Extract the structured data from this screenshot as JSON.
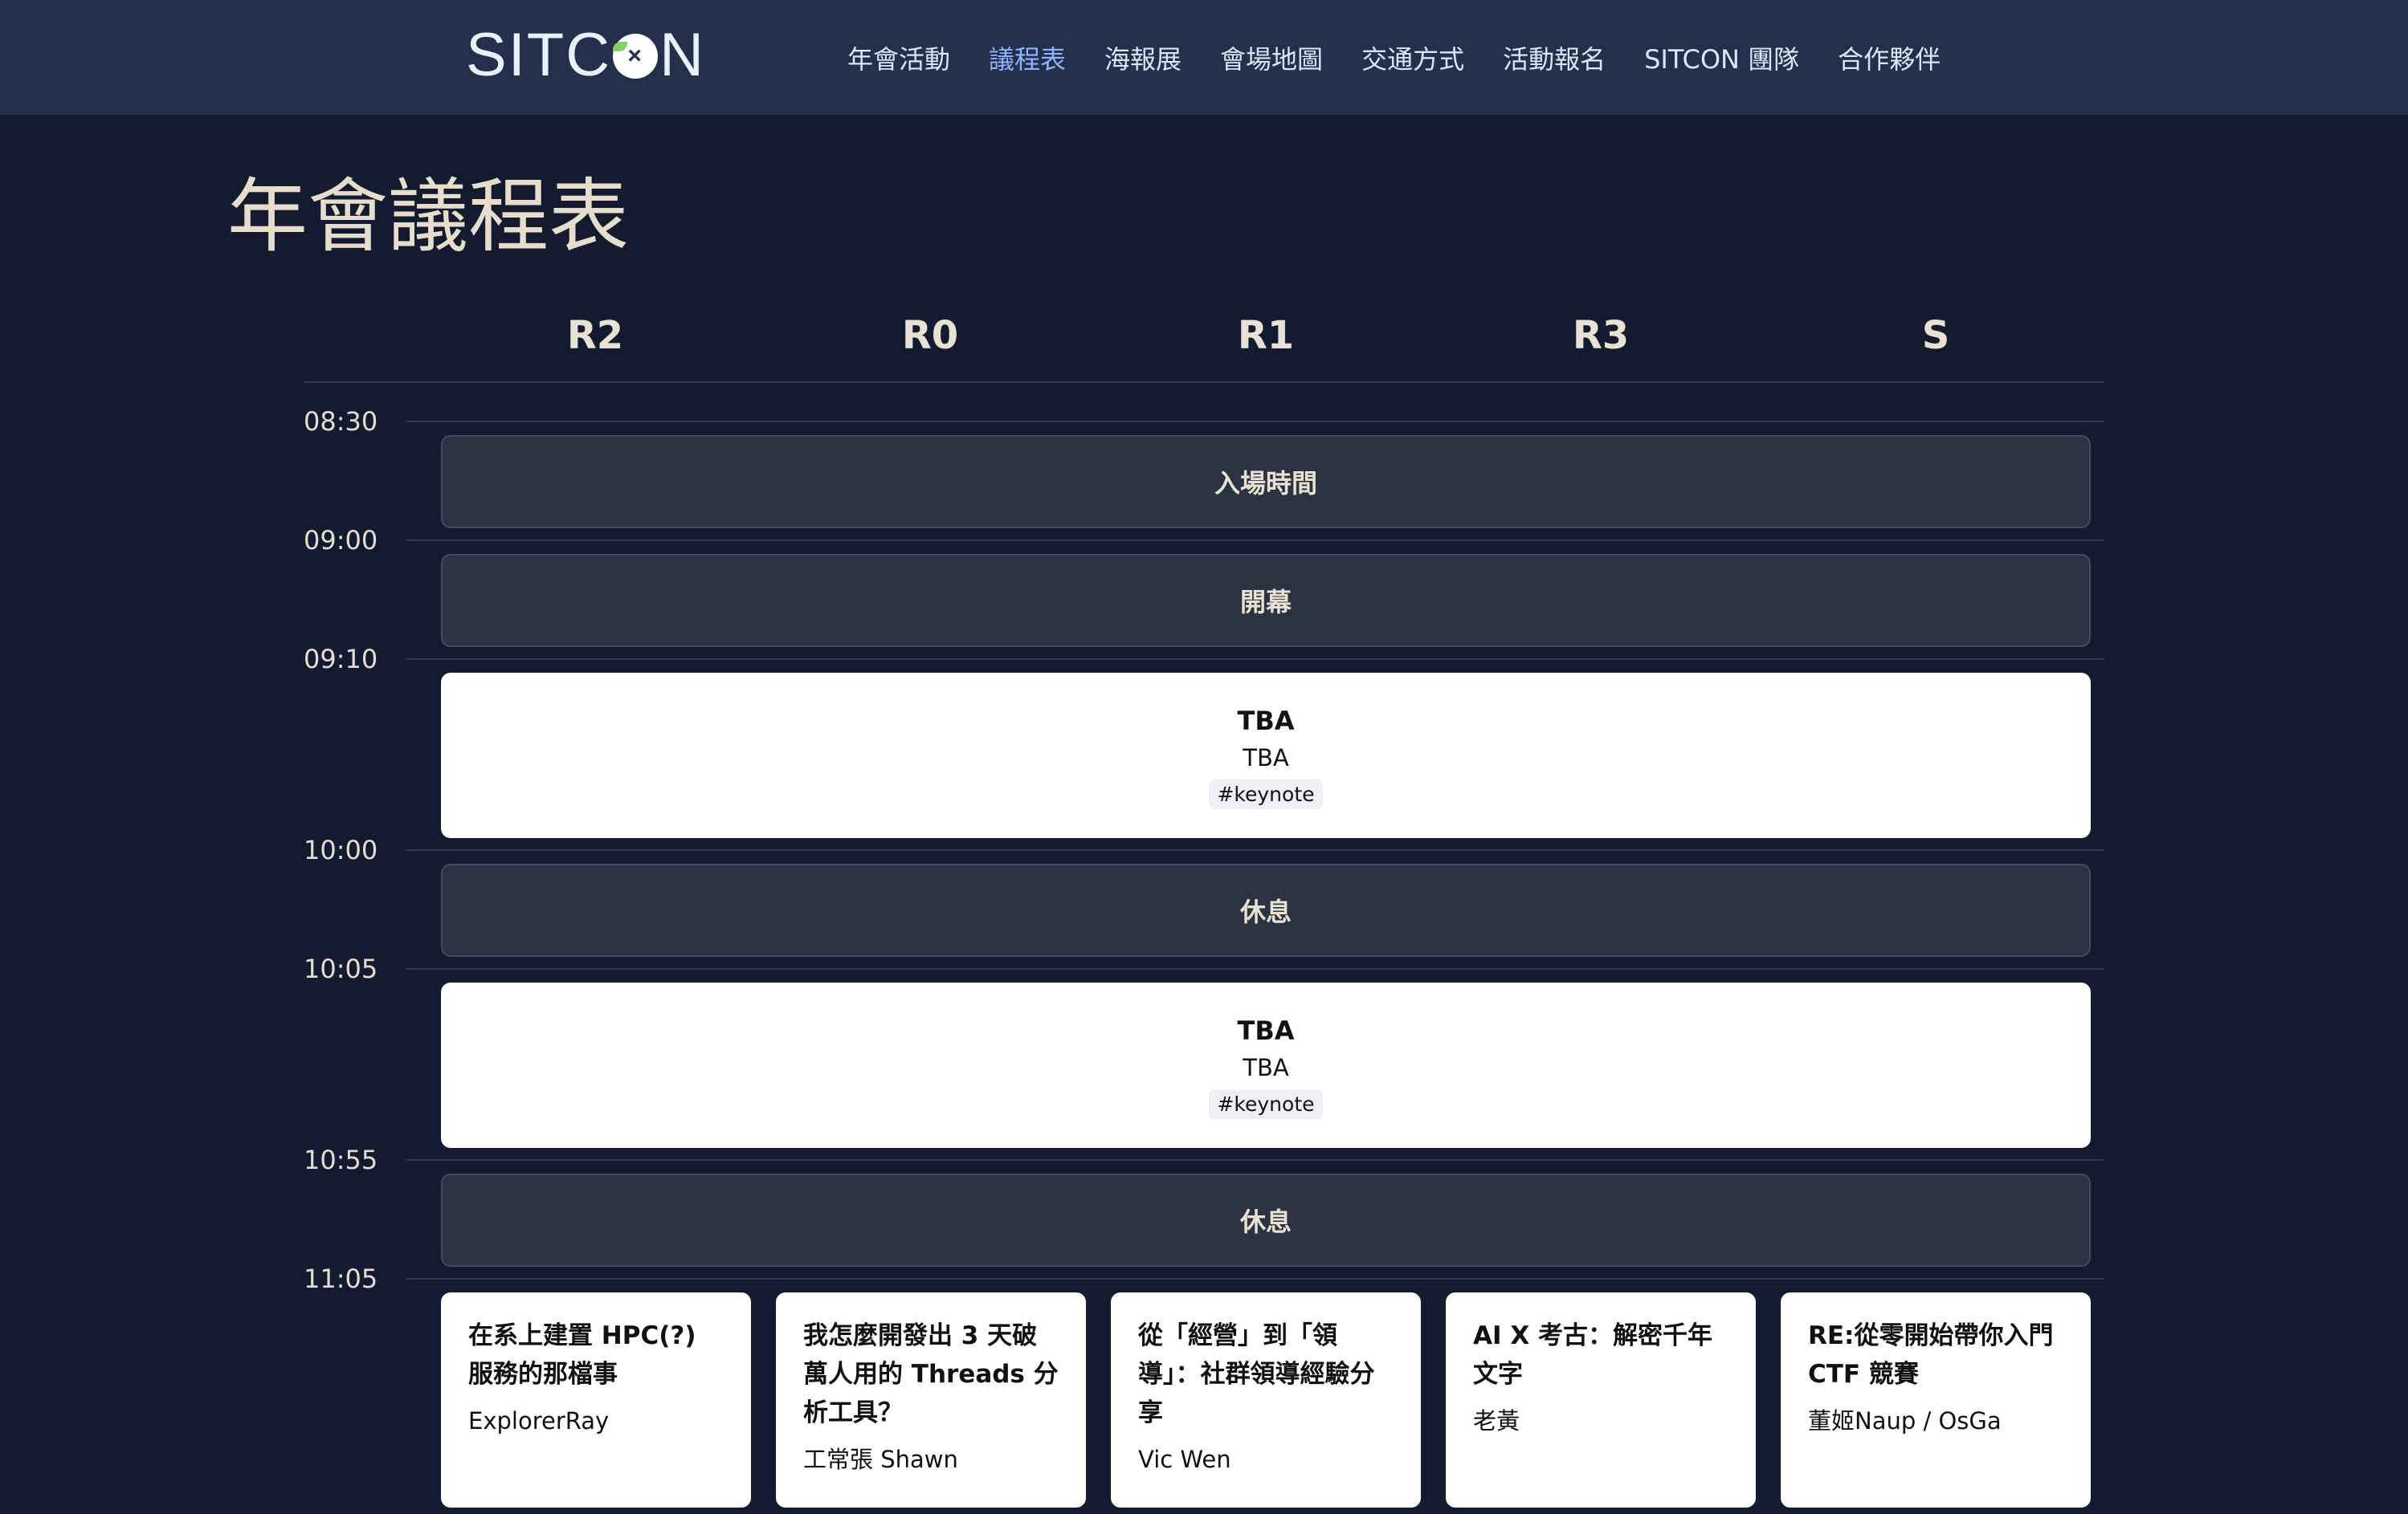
{
  "nav": {
    "logo_text_left": "SITC",
    "logo_x": "×",
    "logo_text_right": "N",
    "links": [
      "年會活動",
      "議程表",
      "海報展",
      "會場地圖",
      "交通方式",
      "活動報名",
      "SITCON 團隊",
      "合作夥伴"
    ],
    "active_index": 1
  },
  "page": {
    "title": "年會議程表"
  },
  "rooms": [
    "R2",
    "R0",
    "R1",
    "R3",
    "S"
  ],
  "times": [
    "08:30",
    "09:00",
    "09:10",
    "10:00",
    "10:05",
    "10:55",
    "11:05"
  ],
  "sessions": [
    {
      "kind": "break",
      "label": "入場時間"
    },
    {
      "kind": "break",
      "label": "開幕"
    },
    {
      "kind": "talk",
      "title": "TBA",
      "speaker": "TBA",
      "tag": "#keynote"
    },
    {
      "kind": "break",
      "label": "休息"
    },
    {
      "kind": "talk",
      "title": "TBA",
      "speaker": "TBA",
      "tag": "#keynote"
    },
    {
      "kind": "break",
      "label": "休息"
    }
  ],
  "parallel_talks": [
    {
      "room": "R2",
      "title": "在系上建置 HPC(?) 服務的那檔事",
      "speaker": "ExplorerRay"
    },
    {
      "room": "R0",
      "title": "我怎麼開發出 3 天破萬人用的 Threads 分析工具？",
      "speaker": "工常張 Shawn"
    },
    {
      "room": "R1",
      "title": "從「經營」到「領導」：社群領導經驗分享",
      "speaker": "Vic Wen"
    },
    {
      "room": "R3",
      "title": "AI X 考古：解密千年文字",
      "speaker": "老黃"
    },
    {
      "room": "S",
      "title": "RE:從零開始帶你入門 CTF 競賽",
      "speaker": "董姬Naup / OsGa"
    }
  ],
  "colors": {
    "background": "#141b30",
    "navbar": "#242f4b",
    "nav_active": "#8fb3ff",
    "break_block": "#2b3242",
    "card": "#ffffff"
  }
}
